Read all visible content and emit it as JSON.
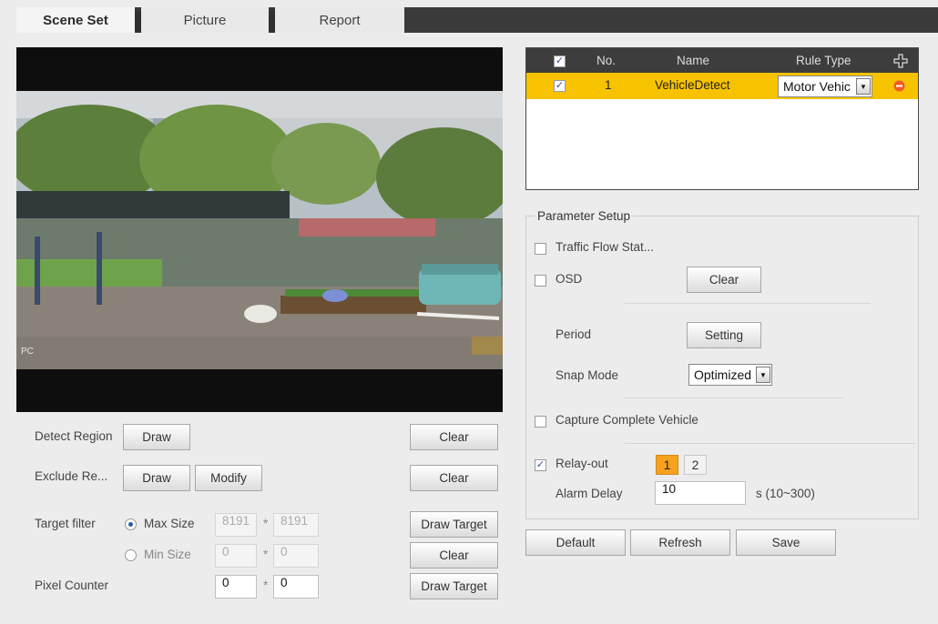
{
  "tabs": [
    {
      "label": "Scene Set"
    },
    {
      "label": "Picture"
    },
    {
      "label": "Report"
    }
  ],
  "video": {
    "label": "PC"
  },
  "left": {
    "detect_region": {
      "label": "Detect Region",
      "draw": "Draw",
      "clear": "Clear"
    },
    "exclude_region": {
      "label": "Exclude Re...",
      "draw": "Draw",
      "modify": "Modify",
      "clear": "Clear"
    },
    "target_filter": {
      "label": "Target filter",
      "max": {
        "label": "Max Size",
        "w": "8191",
        "h": "8191",
        "sep": "*"
      },
      "min": {
        "label": "Min Size",
        "w": "0",
        "h": "0",
        "sep": "*"
      },
      "draw_target": "Draw Target",
      "clear": "Clear"
    },
    "pixel_counter": {
      "label": "Pixel Counter",
      "w": "0",
      "h": "0",
      "sep": "*",
      "draw_target": "Draw Target"
    }
  },
  "rules": {
    "headers": {
      "no": "No.",
      "name": "Name",
      "rule_type": "Rule Type"
    },
    "header_checked": "✓",
    "rows": [
      {
        "checked": "✓",
        "no": "1",
        "name": "VehicleDetect",
        "rule_type": "Motor Vehic"
      }
    ]
  },
  "params": {
    "legend": "Parameter Setup",
    "traffic_flow": {
      "label": "Traffic Flow Stat..."
    },
    "osd": {
      "label": "OSD",
      "clear": "Clear"
    },
    "period": {
      "label": "Period",
      "button": "Setting"
    },
    "snap_mode": {
      "label": "Snap Mode",
      "value": "Optimized"
    },
    "capture_complete": {
      "label": "Capture Complete Vehicle"
    },
    "relay_out": {
      "label": "Relay-out",
      "checked": "✓",
      "options": [
        "1",
        "2"
      ]
    },
    "alarm_delay": {
      "label": "Alarm Delay",
      "value": "10",
      "unit": "s (10~300)"
    }
  },
  "actions": {
    "default": "Default",
    "refresh": "Refresh",
    "save": "Save"
  },
  "colors": {
    "accent": "#f7c200",
    "header": "#3d3d3d",
    "relay_active": "#f7a21e"
  }
}
